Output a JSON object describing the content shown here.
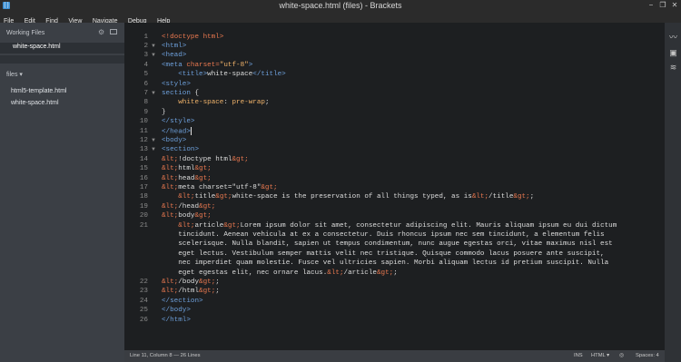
{
  "window": {
    "title": "white-space.html (files) - Brackets"
  },
  "menu": [
    "File",
    "Edit",
    "Find",
    "View",
    "Navigate",
    "Debug",
    "Help"
  ],
  "sidebar": {
    "working_files_label": "Working Files",
    "working_files": [
      "white-space.html"
    ],
    "files_label": "files",
    "files": [
      "html5-template.html",
      "white-space.html"
    ]
  },
  "editor": {
    "lines": [
      {
        "n": "1",
        "fold": "",
        "segs": [
          [
            "t-doc",
            "<!doctype html>"
          ]
        ]
      },
      {
        "n": "2",
        "fold": "▼",
        "segs": [
          [
            "t-br",
            "<html>"
          ]
        ]
      },
      {
        "n": "3",
        "fold": "▼",
        "segs": [
          [
            "t-br",
            "<head>"
          ]
        ]
      },
      {
        "n": "4",
        "fold": "",
        "segs": [
          [
            "t-br",
            "<meta "
          ],
          [
            "t-attr",
            "charset="
          ],
          [
            "t-str",
            "\"utf-8\""
          ],
          [
            "t-br",
            ">"
          ]
        ]
      },
      {
        "n": "5",
        "fold": "",
        "segs": [
          [
            "t-txt",
            "    "
          ],
          [
            "t-br",
            "<title>"
          ],
          [
            "t-txt",
            "white-space"
          ],
          [
            "t-br",
            "</title>"
          ]
        ]
      },
      {
        "n": "6",
        "fold": "",
        "segs": [
          [
            "t-br",
            "<style>"
          ]
        ]
      },
      {
        "n": "7",
        "fold": "▼",
        "segs": [
          [
            "t-sel",
            "section "
          ],
          [
            "t-txt",
            "{"
          ]
        ]
      },
      {
        "n": "8",
        "fold": "",
        "segs": [
          [
            "t-txt",
            "    "
          ],
          [
            "t-prop",
            "white-space"
          ],
          [
            "t-txt",
            ": "
          ],
          [
            "t-val",
            "pre-wrap"
          ],
          [
            "t-txt",
            ";"
          ]
        ]
      },
      {
        "n": "9",
        "fold": "",
        "segs": [
          [
            "t-txt",
            "}"
          ]
        ]
      },
      {
        "n": "10",
        "fold": "",
        "segs": [
          [
            "t-br",
            "</style>"
          ]
        ]
      },
      {
        "n": "11",
        "fold": "",
        "segs": [
          [
            "t-br",
            "</head>"
          ]
        ],
        "cursor": true
      },
      {
        "n": "12",
        "fold": "▼",
        "segs": [
          [
            "t-br",
            "<body>"
          ]
        ]
      },
      {
        "n": "13",
        "fold": "▼",
        "segs": [
          [
            "t-br",
            "<section>"
          ]
        ]
      },
      {
        "n": "14",
        "fold": "",
        "segs": [
          [
            "t-ent",
            "&lt;"
          ],
          [
            "t-txt",
            "!doctype html"
          ],
          [
            "t-ent",
            "&gt;"
          ]
        ]
      },
      {
        "n": "15",
        "fold": "",
        "segs": [
          [
            "t-ent",
            "&lt;"
          ],
          [
            "t-txt",
            "html"
          ],
          [
            "t-ent",
            "&gt;"
          ]
        ]
      },
      {
        "n": "16",
        "fold": "",
        "segs": [
          [
            "t-ent",
            "&lt;"
          ],
          [
            "t-txt",
            "head"
          ],
          [
            "t-ent",
            "&gt;"
          ]
        ]
      },
      {
        "n": "17",
        "fold": "",
        "segs": [
          [
            "t-ent",
            "&lt;"
          ],
          [
            "t-txt",
            "meta charset=\"utf-8\""
          ],
          [
            "t-ent",
            "&gt;"
          ]
        ]
      },
      {
        "n": "18",
        "fold": "",
        "segs": [
          [
            "t-txt",
            "    "
          ],
          [
            "t-ent",
            "&lt;"
          ],
          [
            "t-txt",
            "title"
          ],
          [
            "t-ent",
            "&gt;"
          ],
          [
            "t-txt",
            "white-space is the preservation of all things typed, as is"
          ],
          [
            "t-ent",
            "&lt;"
          ],
          [
            "t-txt",
            "/title"
          ],
          [
            "t-ent",
            "&gt;"
          ],
          [
            "t-txt",
            ";"
          ]
        ]
      },
      {
        "n": "19",
        "fold": "",
        "segs": [
          [
            "t-ent",
            "&lt;"
          ],
          [
            "t-txt",
            "/head"
          ],
          [
            "t-ent",
            "&gt;"
          ]
        ]
      },
      {
        "n": "20",
        "fold": "",
        "segs": [
          [
            "t-ent",
            "&lt;"
          ],
          [
            "t-txt",
            "body"
          ],
          [
            "t-ent",
            "&gt;"
          ]
        ]
      },
      {
        "n": "21",
        "fold": "",
        "segs": [
          [
            "t-txt",
            "    "
          ],
          [
            "t-ent",
            "&lt;"
          ],
          [
            "t-txt",
            "article"
          ],
          [
            "t-ent",
            "&gt;"
          ],
          [
            "t-txt",
            "Lorem ipsum dolor sit amet, consectetur adipiscing elit. Mauris aliquam ipsum eu dui dictum"
          ]
        ]
      },
      {
        "n": "",
        "fold": "",
        "segs": [
          [
            "t-txt",
            "    tincidunt. Aenean vehicula at ex a consectetur. Duis rhoncus ipsum nec sem tincidunt, a elementum felis"
          ]
        ]
      },
      {
        "n": "",
        "fold": "",
        "segs": [
          [
            "t-txt",
            "    scelerisque. Nulla blandit, sapien ut tempus condimentum, nunc augue egestas orci, vitae maximus nisl est"
          ]
        ]
      },
      {
        "n": "",
        "fold": "",
        "segs": [
          [
            "t-txt",
            "    eget lectus. Vestibulum semper mattis velit nec tristique. Quisque commodo lacus posuere ante suscipit,"
          ]
        ]
      },
      {
        "n": "",
        "fold": "",
        "segs": [
          [
            "t-txt",
            "    nec imperdiet quam molestie. Fusce vel ultricies sapien. Morbi aliquam lectus id pretium suscipit. Nulla"
          ]
        ]
      },
      {
        "n": "",
        "fold": "",
        "segs": [
          [
            "t-txt",
            "    eget egestas elit, nec ornare lacus."
          ],
          [
            "t-ent",
            "&lt;"
          ],
          [
            "t-txt",
            "/article"
          ],
          [
            "t-ent",
            "&gt;"
          ],
          [
            "t-txt",
            ";"
          ]
        ]
      },
      {
        "n": "22",
        "fold": "",
        "segs": [
          [
            "t-ent",
            "&lt;"
          ],
          [
            "t-txt",
            "/body"
          ],
          [
            "t-ent",
            "&gt;"
          ],
          [
            "t-txt",
            ";"
          ]
        ]
      },
      {
        "n": "23",
        "fold": "",
        "segs": [
          [
            "t-ent",
            "&lt;"
          ],
          [
            "t-txt",
            "/html"
          ],
          [
            "t-ent",
            "&gt;"
          ],
          [
            "t-txt",
            ";"
          ]
        ]
      },
      {
        "n": "24",
        "fold": "",
        "segs": [
          [
            "t-br",
            "</section>"
          ]
        ]
      },
      {
        "n": "25",
        "fold": "",
        "segs": [
          [
            "t-br",
            "</body>"
          ]
        ]
      },
      {
        "n": "26",
        "fold": "",
        "segs": [
          [
            "t-br",
            "</html>"
          ]
        ]
      }
    ]
  },
  "status": {
    "position": "Line 11, Column 8 — 26 Lines",
    "ins": "INS",
    "mode": "HTML ▾",
    "spaces": "Spaces: 4"
  },
  "icons": [
    "live-preview-icon",
    "extension-manager-icon",
    "layers-icon"
  ]
}
